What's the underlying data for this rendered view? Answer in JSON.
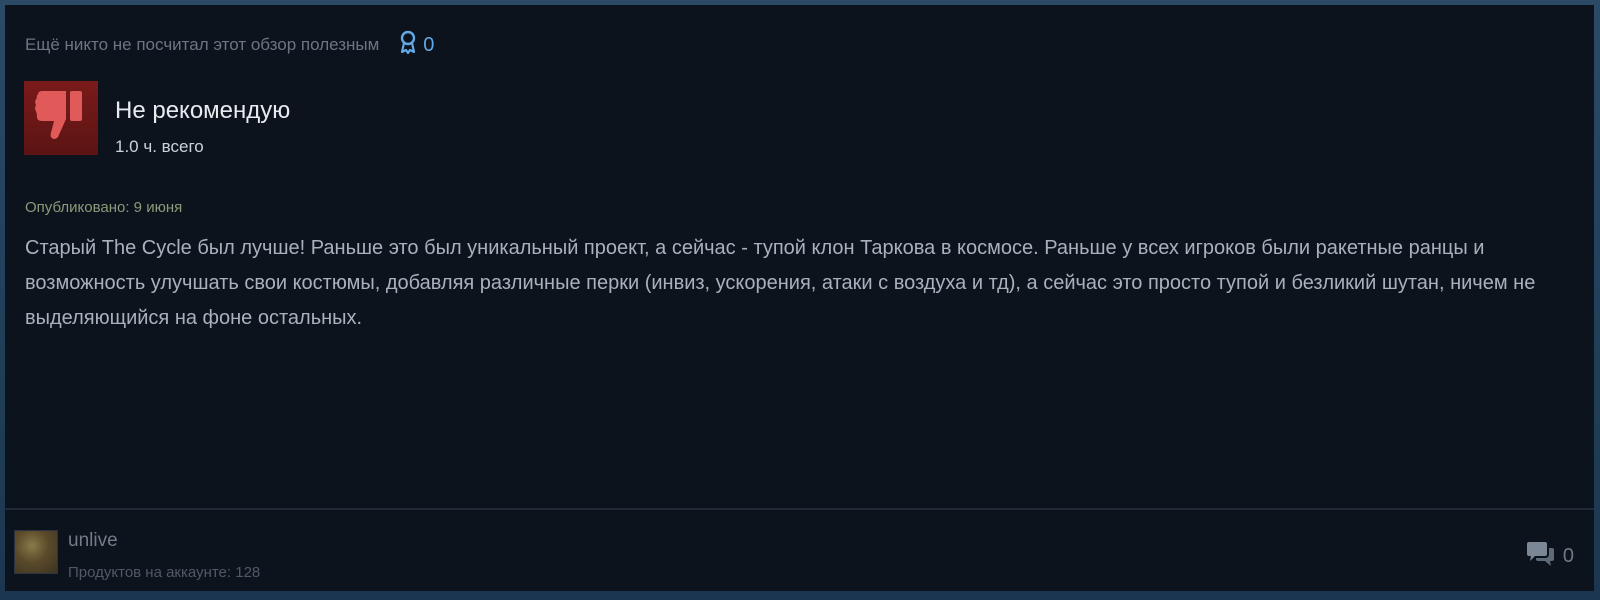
{
  "review": {
    "helpful_text": "Ещё никто не посчитал этот обзор полезным",
    "award_count": "0",
    "verdict": "Не рекомендую",
    "hours": "1.0 ч. всего",
    "posted": "Опубликовано: 9 июня",
    "body": "Старый The Cycle был лучше! Раньше это был уникальный проект, а сейчас - тупой клон Таркова в космосе. Раньше у всех игроков были ракетные ранцы и возможность улучшать свои костюмы, добавляя различные перки (инвиз, ускорения, атаки с воздуха и тд), а сейчас это просто тупой и безликий шутан, ничем не выделяющийся на фоне остальных."
  },
  "author": {
    "name": "unlive",
    "products": "Продуктов на аккаунте: 128"
  },
  "comments": {
    "count": "0"
  },
  "icons": {
    "award": "award-icon",
    "verdict": "thumbs-down-icon",
    "comment": "comment-icon"
  },
  "colors": {
    "card_bg": "#0d131c",
    "verdict_bg": "#7a1a1a",
    "thumb": "#e05a5a",
    "award": "#62a8e4"
  }
}
